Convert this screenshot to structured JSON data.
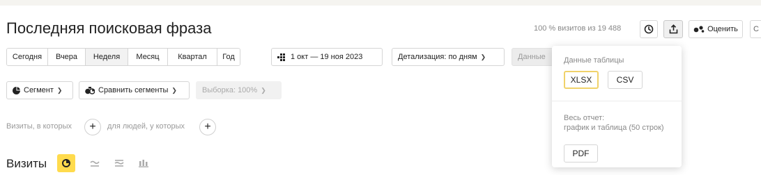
{
  "report": {
    "title": "Последняя поисковая фраза",
    "stats": "100 % визитов из 19 488"
  },
  "toolbar": {
    "history_icon": "clock-icon",
    "export_icon": "export-icon",
    "rate_label": "Оценить",
    "rate_icon": "rate-icon",
    "cut_label": "С"
  },
  "periods": [
    "Сегодня",
    "Вчера",
    "Неделя",
    "Месяц",
    "Квартал",
    "Год"
  ],
  "active_period": "Неделя",
  "date_range": {
    "label": "1 окт — 19 ноя 2023",
    "icon": "calendar-icon"
  },
  "detail": {
    "label": "Детализация: по дням"
  },
  "data_button": {
    "label": "Данные"
  },
  "segment": {
    "segment_label": "Сегмент",
    "compare_label": "Сравнить сегменты",
    "sample_label": "Выборка: 100%"
  },
  "filters": {
    "visits_where": "Визиты, в которых",
    "for_people": "для людей, у которых"
  },
  "visits": {
    "title": "Визиты",
    "view_icons": [
      "pie-chart-icon",
      "line-chart-icon",
      "area-chart-icon",
      "bar-chart-icon"
    ],
    "active_view": 0
  },
  "export_popup": {
    "table_title": "Данные таблицы",
    "xlsx": "XLSX",
    "csv": "CSV",
    "report_title": "Весь отчет:",
    "report_sub": "график и таблица (50 строк)",
    "pdf": "PDF"
  },
  "colors": {
    "accent": "#ffdb4d",
    "popup_selected_border": "#f0d26a"
  }
}
